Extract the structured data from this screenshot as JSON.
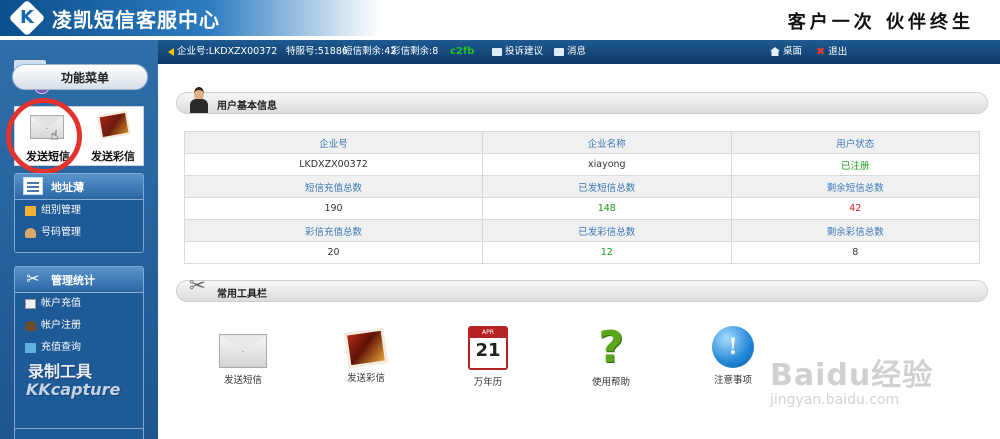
{
  "header": {
    "logo_letter": "K",
    "title": "凌凯短信客服中心",
    "slogan": "客户一次 伙伴终生"
  },
  "status": {
    "enterprise": "企业号:LKDXZX00372",
    "special": "特服号:51886",
    "sms_left": "短信剩余:42",
    "mms_left": "彩信剩余:8",
    "green_label": "c2fb",
    "suggest": "投诉建议",
    "message": "消息",
    "desktop": "桌面",
    "logout": "退出"
  },
  "sidebar": {
    "menu_title": "功能菜单",
    "send_sms": "发送短信",
    "send_mms": "发送彩信",
    "address_book": {
      "title": "地址薄",
      "items": [
        "组别管理",
        "号码管理"
      ]
    },
    "management": {
      "title": "管理统计",
      "items": [
        "帐户充值",
        "帐户注册",
        "充值查询"
      ]
    },
    "watermark_1": "录制工具",
    "watermark_2": "KKcapture"
  },
  "basic_info": {
    "title": "用户基本信息",
    "rows": [
      [
        "企业号",
        "企业名称",
        "用户状态"
      ],
      [
        "LKDXZX00372",
        "xiayong",
        "已注册"
      ],
      [
        "短信充值总数",
        "已发短信总数",
        "剩余短信总数"
      ],
      [
        "190",
        "148",
        "42"
      ],
      [
        "彩信充值总数",
        "已发彩信总数",
        "剩余彩信总数"
      ],
      [
        "20",
        "12",
        "8"
      ]
    ]
  },
  "tools": {
    "title": "常用工具栏",
    "calendar_month": "APR",
    "calendar_day": "21",
    "items": [
      "发送短信",
      "发送彩信",
      "万年历",
      "使用帮助",
      "注意事项"
    ]
  },
  "watermark": {
    "baidu": "Baidu经验",
    "url": "jingyan.baidu.com"
  },
  "colors": {
    "accent_blue": "#1f5a91",
    "highlight_red": "#e4332e",
    "value_green": "#1a9a1a",
    "value_red": "#d42020"
  }
}
